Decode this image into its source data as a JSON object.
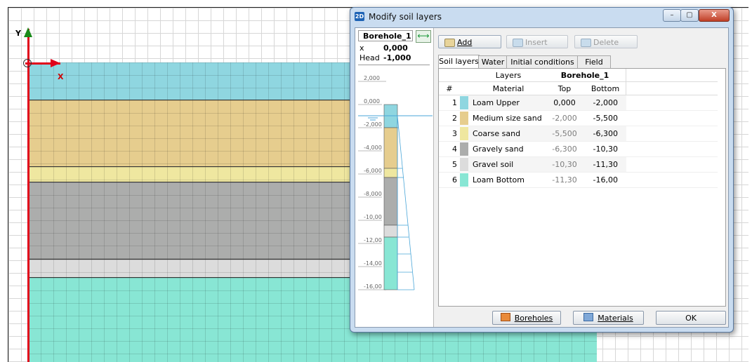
{
  "canvas": {
    "axis_y_label": "Y",
    "axis_x_label": "X",
    "layers": [
      {
        "name": "Loam Upper",
        "color": "#8fd6e0"
      },
      {
        "name": "Medium size sand",
        "color": "#e6cd8e"
      },
      {
        "name": "Coarse sand",
        "color": "#efe7a0"
      },
      {
        "name": "Gravely sand",
        "color": "#acadac"
      },
      {
        "name": "Gravel soil",
        "color": "#dcdcdc"
      },
      {
        "name": "Loam Bottom",
        "color": "#88e6d4"
      }
    ]
  },
  "dialog": {
    "title": "Modify soil layers",
    "app_icon": "2D",
    "window_buttons": {
      "minimize": "–",
      "maximize": "▢",
      "close": "X"
    },
    "borehole": {
      "name": "Borehole_1",
      "x_label": "x",
      "x_value": "0,000",
      "head_label": "Head",
      "head_value": "-1,000",
      "depth_ticks": [
        "2,000",
        "0,000",
        "-2,000",
        "-4,000",
        "-6,000",
        "-8,000",
        "-10,00",
        "-12,00",
        "-14,00",
        "-16,00"
      ]
    },
    "toolbar": {
      "add_label": "Add",
      "insert_label": "Insert",
      "delete_label": "Delete"
    },
    "tabs": {
      "soil_layers": "Soil layers",
      "water": "Water",
      "initial_conditions": "Initial conditions",
      "field_data": "Field data"
    },
    "table": {
      "group_header_layers": "Layers",
      "group_header_borehole": "Borehole_1",
      "col_num": "#",
      "col_material": "Material",
      "col_top": "Top",
      "col_bottom": "Bottom",
      "rows": [
        {
          "num": "1",
          "material": "Loam Upper",
          "top": "0,000",
          "bottom": "-2,000",
          "color": "#8fd6e0"
        },
        {
          "num": "2",
          "material": "Medium size sand",
          "top": "-2,000",
          "bottom": "-5,500",
          "color": "#e6cd8e"
        },
        {
          "num": "3",
          "material": "Coarse sand",
          "top": "-5,500",
          "bottom": "-6,300",
          "color": "#efe7a0"
        },
        {
          "num": "4",
          "material": "Gravely sand",
          "top": "-6,300",
          "bottom": "-10,30",
          "color": "#acadac"
        },
        {
          "num": "5",
          "material": "Gravel soil",
          "top": "-10,30",
          "bottom": "-11,30",
          "color": "#dcdcdc"
        },
        {
          "num": "6",
          "material": "Loam Bottom",
          "top": "-11,30",
          "bottom": "-16,00",
          "color": "#88e6d4"
        }
      ]
    },
    "bottom_buttons": {
      "boreholes": "Boreholes",
      "materials": "Materials",
      "ok": "OK"
    }
  }
}
